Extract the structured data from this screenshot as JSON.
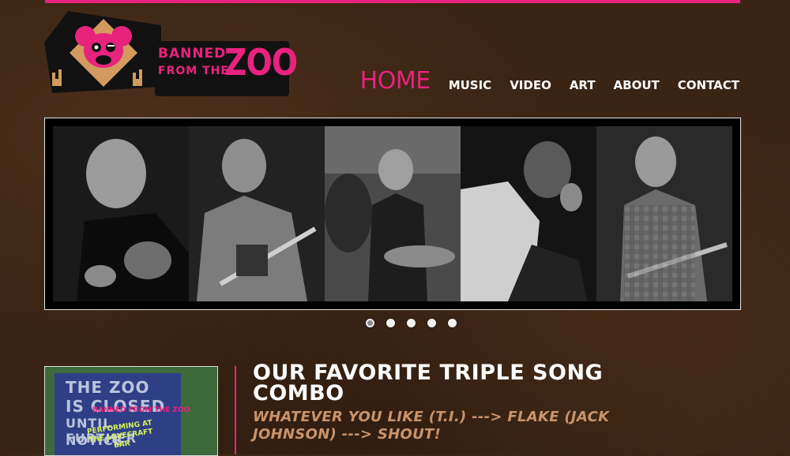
{
  "brand": {
    "logo_lines": [
      "BANNED",
      "FROM THE",
      "ZOO"
    ],
    "colors": {
      "accent": "#e8237d",
      "background": "#3a2414",
      "subtitle": "#c9936b",
      "text": "#ffffff"
    }
  },
  "nav": {
    "items": [
      {
        "label": "HOME",
        "active": true
      },
      {
        "label": "MUSIC",
        "active": false
      },
      {
        "label": "VIDEO",
        "active": false
      },
      {
        "label": "ART",
        "active": false
      },
      {
        "label": "ABOUT",
        "active": false
      },
      {
        "label": "CONTACT",
        "active": false
      }
    ]
  },
  "slider": {
    "slide_count": 5,
    "active_slide": 1
  },
  "post": {
    "thumbnail": {
      "sign_lines": [
        "THE ZOO",
        "IS CLOSED",
        "UNTIL FURTHER",
        "NOTICE"
      ],
      "mini_logo": "BANNED FROM THE ZOO",
      "performing": "PERFORMING AT THE LOVECRAFT BAR"
    },
    "title": "OUR FAVORITE TRIPLE SONG COMBO",
    "subtitle": "WHATEVER YOU LIKE (T.I.) ---> FLAKE (JACK JOHNSON) ---> SHOUT!"
  }
}
